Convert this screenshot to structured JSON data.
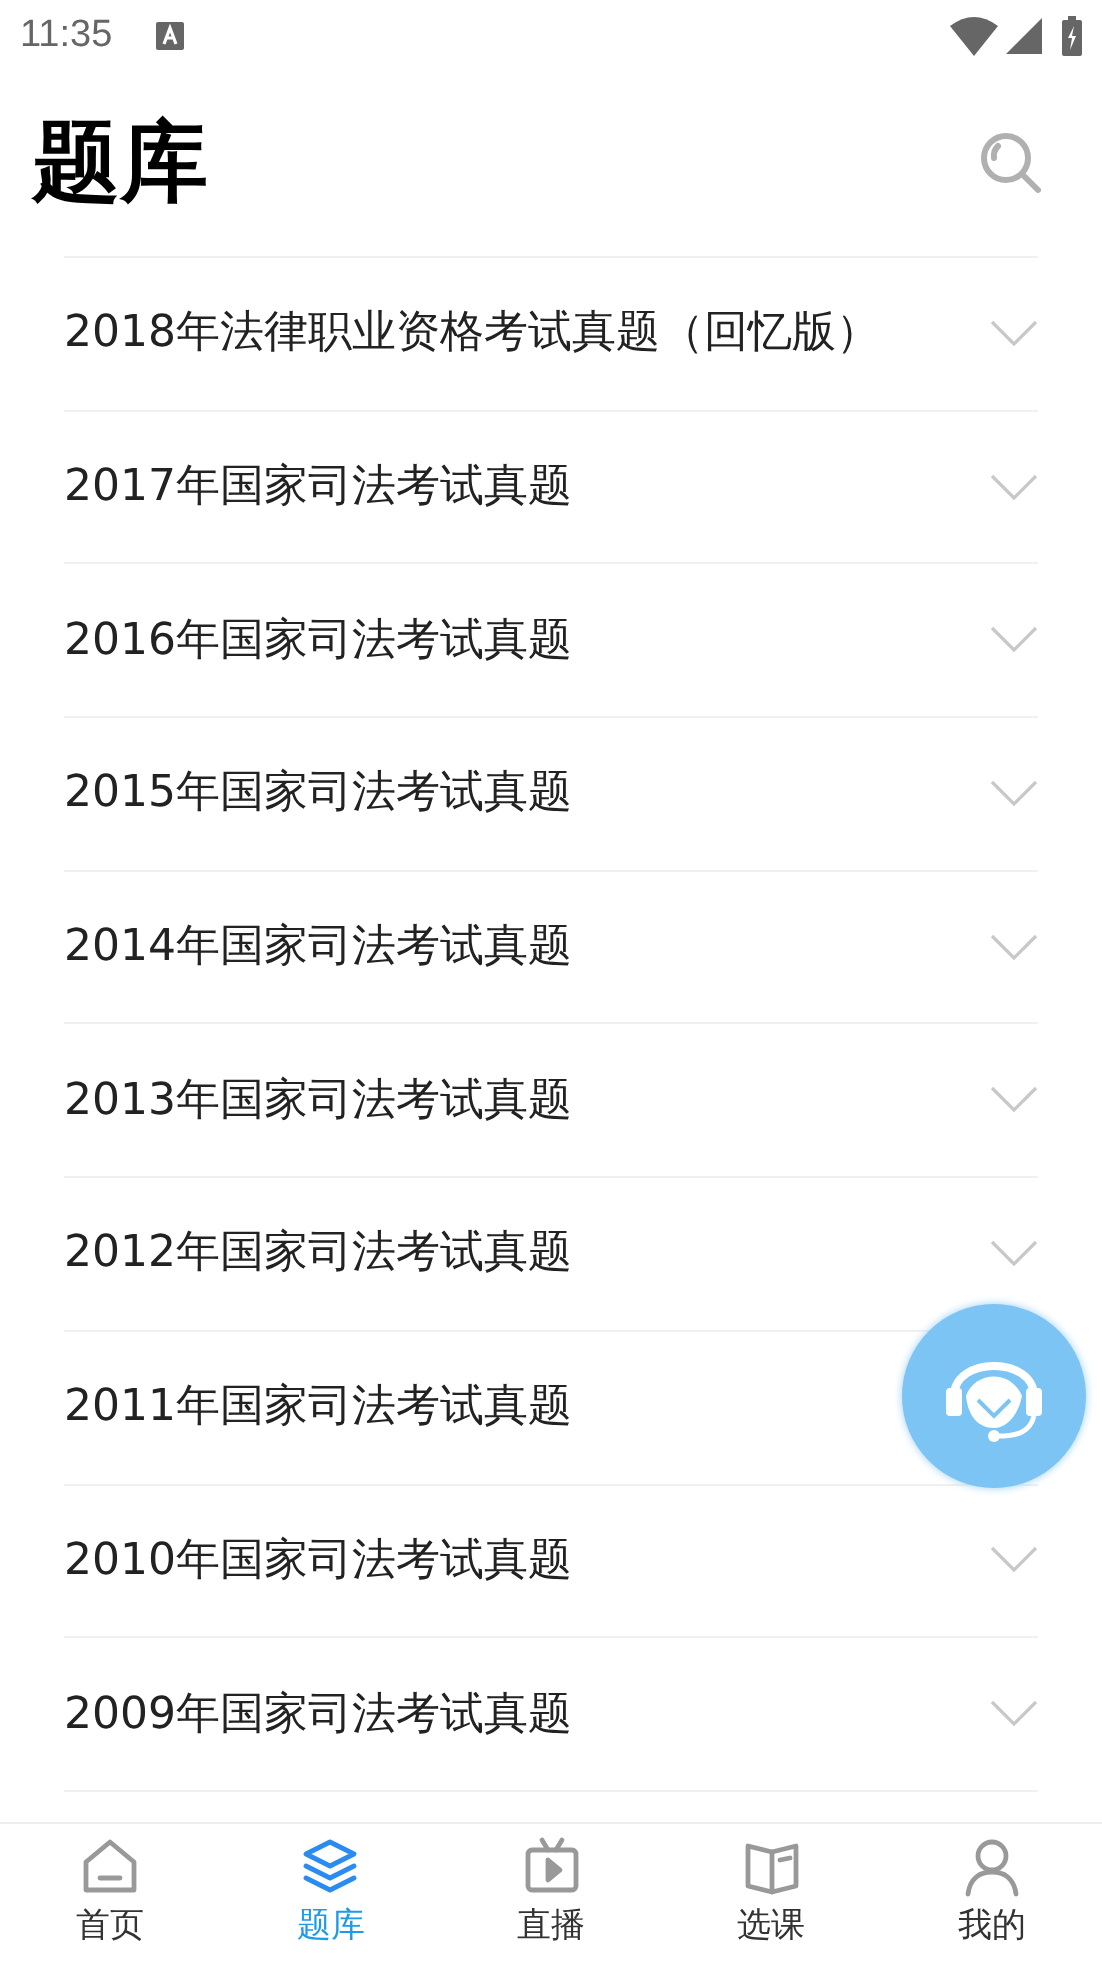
{
  "status_bar": {
    "time": "11:35"
  },
  "header": {
    "title": "题库"
  },
  "items": [
    {
      "title": "2018年法律职业资格考试真题（回忆版）",
      "chevron": true
    },
    {
      "title": "2017年国家司法考试真题",
      "chevron": true
    },
    {
      "title": "2016年国家司法考试真题",
      "chevron": true
    },
    {
      "title": "2015年国家司法考试真题",
      "chevron": true
    },
    {
      "title": "2014年国家司法考试真题",
      "chevron": true
    },
    {
      "title": "2013年国家司法考试真题",
      "chevron": true
    },
    {
      "title": "2012年国家司法考试真题",
      "chevron": true
    },
    {
      "title": "2011年国家司法考试真题",
      "chevron": false
    },
    {
      "title": "2010年国家司法考试真题",
      "chevron": true
    },
    {
      "title": "2009年国家司法考试真题",
      "chevron": true
    }
  ],
  "tabs": [
    {
      "label": "首页",
      "kind": "home",
      "selected": false
    },
    {
      "label": "题库",
      "kind": "bank",
      "selected": true
    },
    {
      "label": "直播",
      "kind": "live",
      "selected": false
    },
    {
      "label": "选课",
      "kind": "course",
      "selected": false
    },
    {
      "label": "我的",
      "kind": "me",
      "selected": false
    }
  ]
}
